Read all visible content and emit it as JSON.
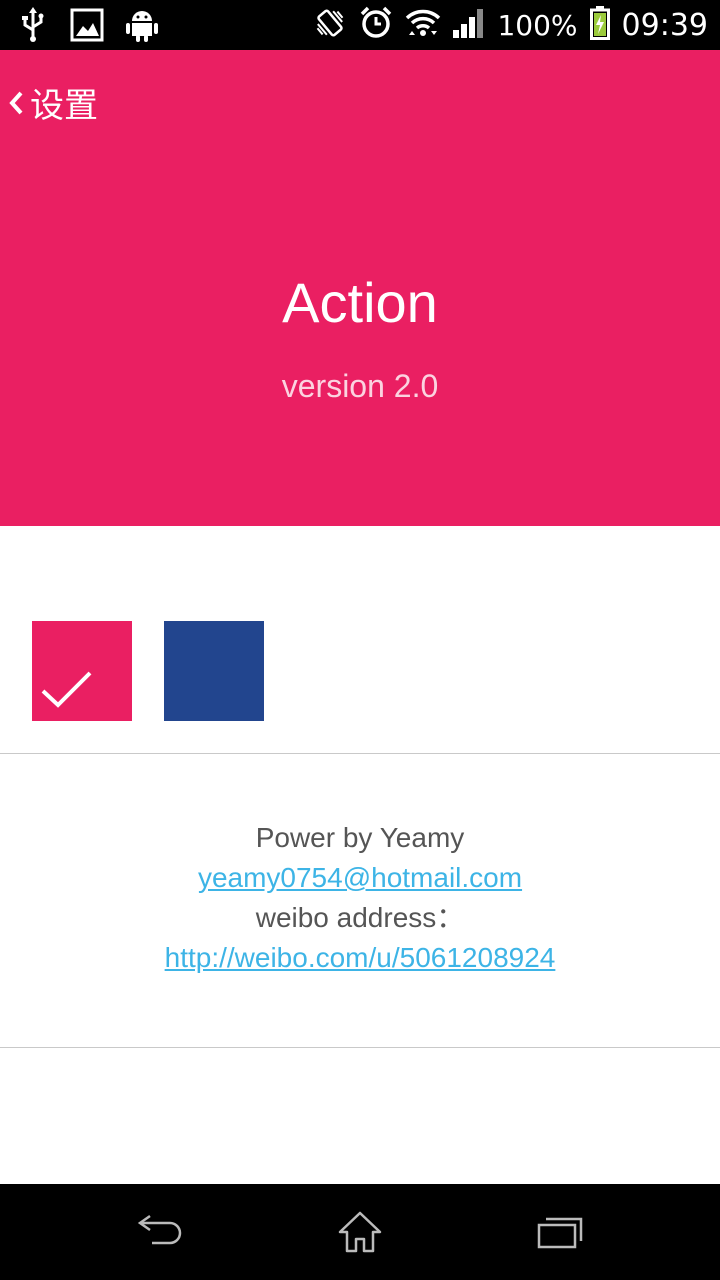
{
  "status_bar": {
    "battery": "100%",
    "time": "09:39",
    "left_icons": [
      "usb-icon",
      "image-icon",
      "android-icon"
    ],
    "right_icons": [
      "vibrate-icon",
      "alarm-icon",
      "wifi-icon",
      "signal-icon",
      "battery-icon"
    ]
  },
  "header": {
    "back_label": "设置",
    "app_name": "Action",
    "version": "version 2.0",
    "background_color": "#EA1F62"
  },
  "theme_swatches": [
    {
      "color": "#EA1F62",
      "selected": true
    },
    {
      "color": "#22458E",
      "selected": false
    }
  ],
  "credits": {
    "line1": "Power by Yeamy",
    "email": "yeamy0754@hotmail.com",
    "weibo_label": "weibo address：",
    "weibo_url": "http://weibo.com/u/5061208924",
    "link_color": "#3DB4E6"
  },
  "nav_bar": {
    "buttons": [
      "back-icon",
      "home-icon",
      "recent-apps-icon"
    ]
  }
}
